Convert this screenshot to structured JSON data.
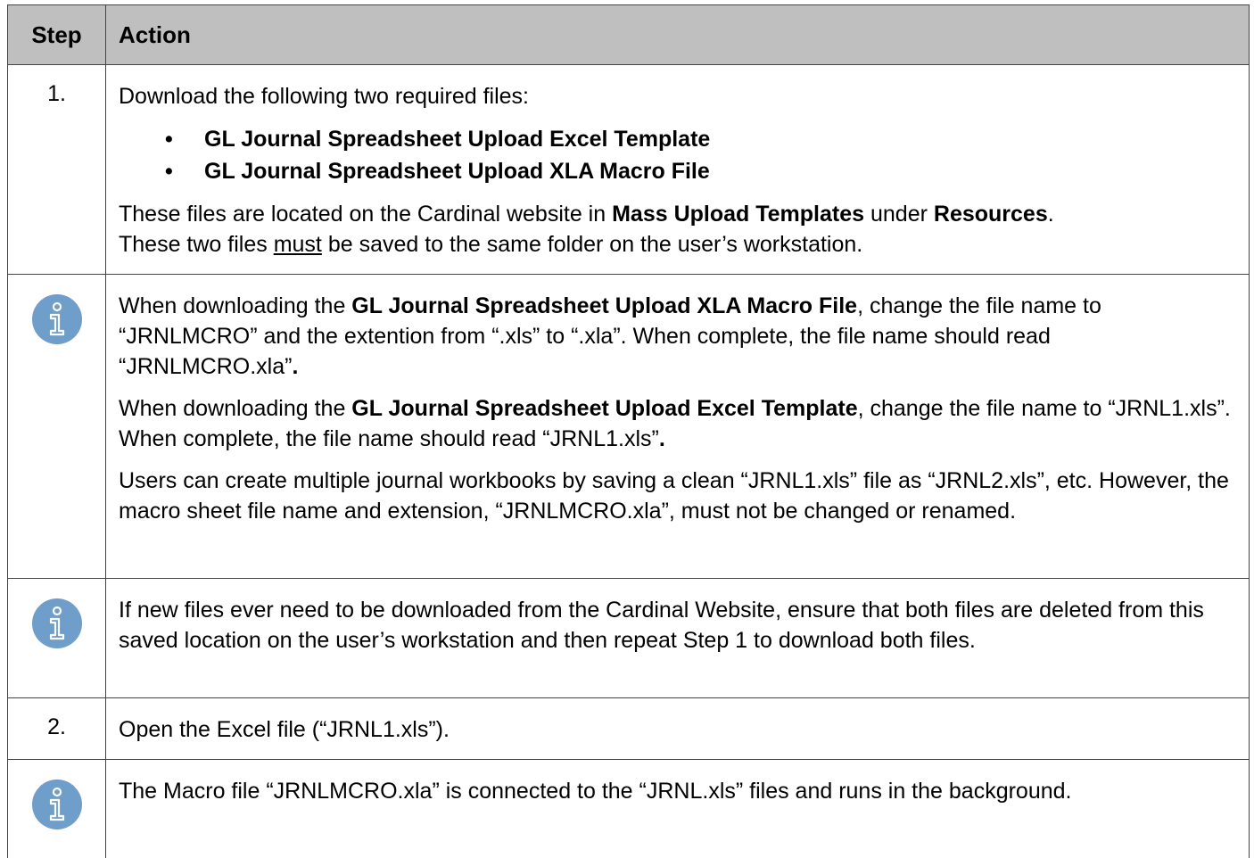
{
  "table": {
    "header": {
      "step": "Step",
      "action": "Action"
    },
    "row1": {
      "num": "1.",
      "intro": "Download the following two required files:",
      "files": [
        "GL Journal Spreadsheet Upload Excel Template",
        "GL Journal Spreadsheet Upload XLA Macro File"
      ],
      "loc_a": "These files are located on the Cardinal website in ",
      "loc_b": "Mass Upload Templates",
      "loc_c": " under ",
      "loc_d": "Resources",
      "loc_e": ".",
      "save_a": "These two files ",
      "save_b": "must",
      "save_c": " be saved to the same folder on the user’s workstation."
    },
    "note1": {
      "icon": "info-icon",
      "p1_a": "When downloading the ",
      "p1_b": "GL Journal Spreadsheet Upload XLA Macro File",
      "p1_c": ", change the file name to “JRNLMCRO” and the extention from “.xls” to “.xla”. When complete, the file name should read “JRNLMCRO.xla”",
      "p1_d": ".",
      "p2_a": "When downloading the ",
      "p2_b": "GL Journal Spreadsheet Upload Excel Template",
      "p2_c": ", change the file name to “JRNL1.xls”. When complete, the file name should read “JRNL1.xls”",
      "p2_d": ".",
      "p3": "Users can create multiple journal workbooks by saving a clean “JRNL1.xls” file as “JRNL2.xls”, etc. However, the macro sheet file name and extension, “JRNLMCRO.xla”, must not be changed or renamed."
    },
    "note2": {
      "icon": "info-icon",
      "text": "If new files ever need to be downloaded from the Cardinal Website, ensure that both files are deleted from this saved location on the user’s workstation and then repeat Step 1 to download both files."
    },
    "row2": {
      "num": "2.",
      "text": "Open the Excel file (“JRNL1.xls”)."
    },
    "note3": {
      "icon": "info-icon",
      "text": "The Macro file “JRNLMCRO.xla” is connected to the “JRNL.xls” files and runs in the background."
    },
    "colors": {
      "header_bg": "#bfbfbf",
      "icon_fill": "#6e9ec9"
    }
  }
}
